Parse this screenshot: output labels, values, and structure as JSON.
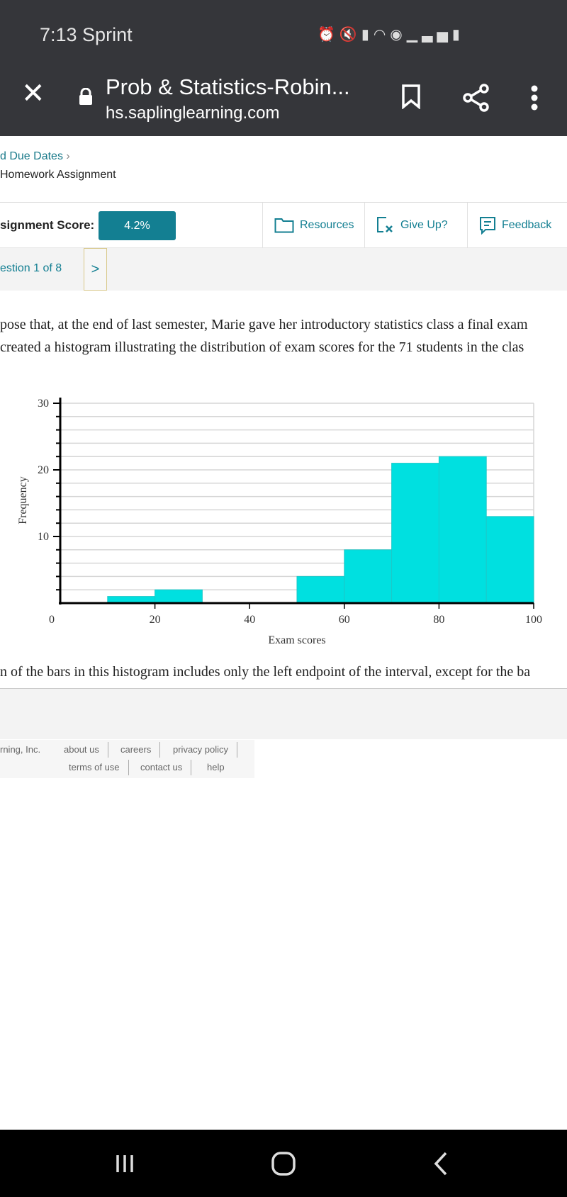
{
  "status_bar": {
    "time_carrier": "7:13 Sprint",
    "icons": [
      "alarm-icon",
      "mute-icon",
      "battery-saver-icon",
      "wifi-icon",
      "volte-icon",
      "signal-icon",
      "battery-icon"
    ]
  },
  "browser": {
    "title": "Prob & Statistics-Robin...",
    "url": "hs.saplinglearning.com"
  },
  "breadcrumb": {
    "parent": "d Due Dates",
    "current": "Homework Assignment"
  },
  "score": {
    "label": "signment Score:",
    "value": "4.2%"
  },
  "tools": {
    "resources": "Resources",
    "give_up": "Give Up?",
    "feedback": "Feedback"
  },
  "question": {
    "label": "estion 1 of 8",
    "next": ">"
  },
  "text": {
    "line1": "pose that, at the end of last semester, Marie gave her introductory statistics class a final exam",
    "line2": "created a histogram illustrating the distribution of exam scores for the 71 students in the clas",
    "line3": "n of the bars in this histogram includes only the left endpoint of the interval, except for the ba"
  },
  "chart_data": {
    "type": "bar",
    "xlabel": "Exam scores",
    "ylabel": "Frequency",
    "bin_edges": [
      0,
      10,
      20,
      30,
      40,
      50,
      60,
      70,
      80,
      90,
      100
    ],
    "values": [
      0,
      1,
      2,
      0,
      0,
      4,
      8,
      21,
      22,
      13
    ],
    "xlim": [
      0,
      100
    ],
    "ylim": [
      0,
      30
    ],
    "xticks": [
      "0",
      "20",
      "40",
      "60",
      "80",
      "100"
    ],
    "yticks": [
      "10",
      "20",
      "30"
    ],
    "grid": true,
    "bar_color": "#00e0e0"
  },
  "footer": {
    "copyright": "rning, Inc.",
    "links": [
      "about us",
      "careers",
      "privacy policy",
      "terms of use",
      "contact us",
      "help"
    ]
  },
  "accent_color": "#137f92"
}
